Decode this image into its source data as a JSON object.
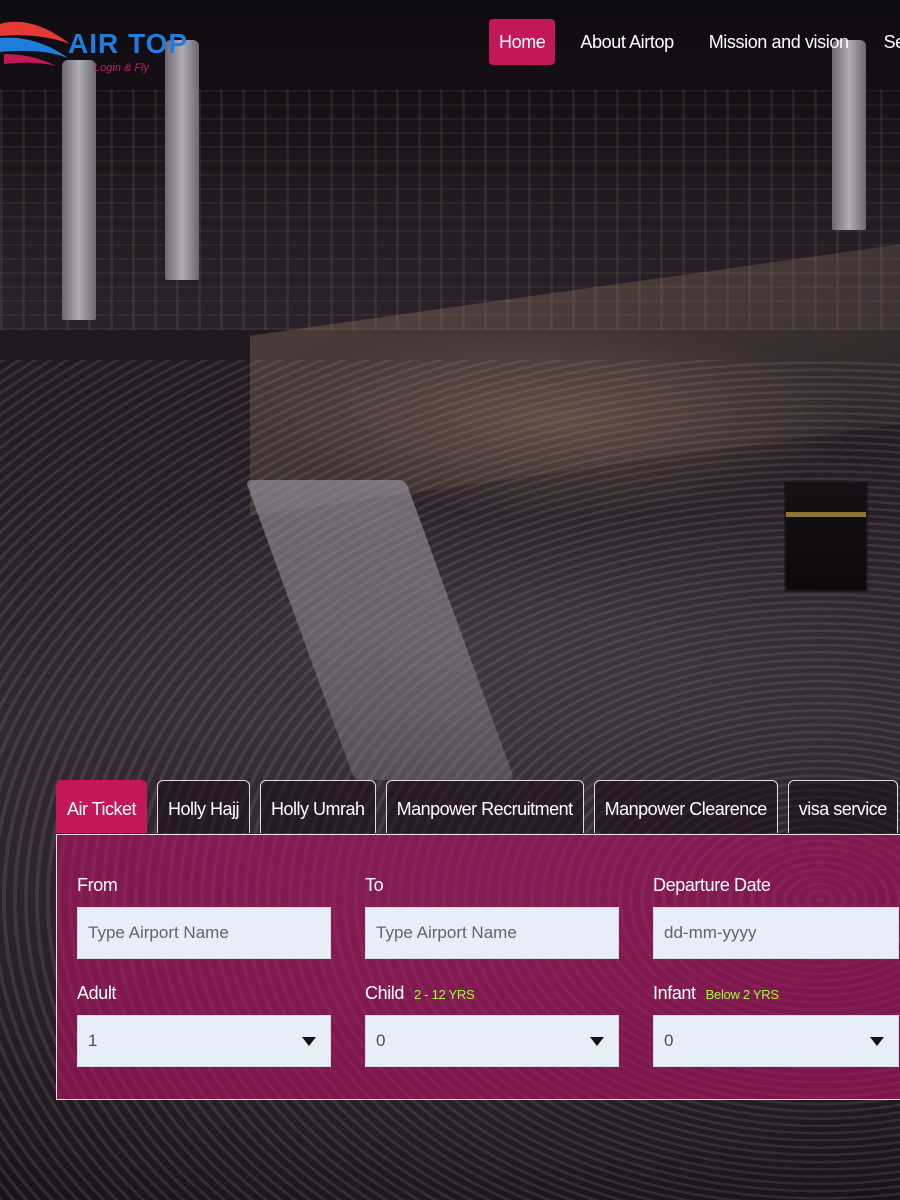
{
  "header": {
    "logo_title": "AIR TOP",
    "logo_tagline": "Login & Fly",
    "brand_colors": {
      "primary": "#1f7ddb",
      "accent": "#c2185b",
      "wing_red": "#e53935"
    },
    "nav": [
      {
        "label": "Home",
        "active": true
      },
      {
        "label": "About Airtop",
        "active": false
      },
      {
        "label": "Mission and vision",
        "active": false
      },
      {
        "label": "Servi",
        "active": false
      }
    ]
  },
  "booking": {
    "tabs": [
      {
        "label": "Air Ticket",
        "active": true
      },
      {
        "label": "Holly Hajj",
        "active": false
      },
      {
        "label": "Holly Umrah",
        "active": false
      },
      {
        "label": "Manpower Recruitment",
        "active": false
      },
      {
        "label": "Manpower Clearence",
        "active": false
      },
      {
        "label": "visa service",
        "active": false
      }
    ],
    "from": {
      "label": "From",
      "placeholder": "Type Airport Name",
      "value": ""
    },
    "to": {
      "label": "To",
      "placeholder": "Type Airport Name",
      "value": ""
    },
    "departure": {
      "label": "Departure Date",
      "placeholder": "dd-mm-yyyy",
      "value": ""
    },
    "adult": {
      "label": "Adult",
      "value": "1"
    },
    "child": {
      "label": "Child",
      "note": "2 - 12 YRS",
      "value": "0"
    },
    "infant": {
      "label": "Infant",
      "note": "Below 2 YRS",
      "value": "0"
    },
    "note_color": "#9dff3a",
    "panel_color": "#b21462"
  }
}
